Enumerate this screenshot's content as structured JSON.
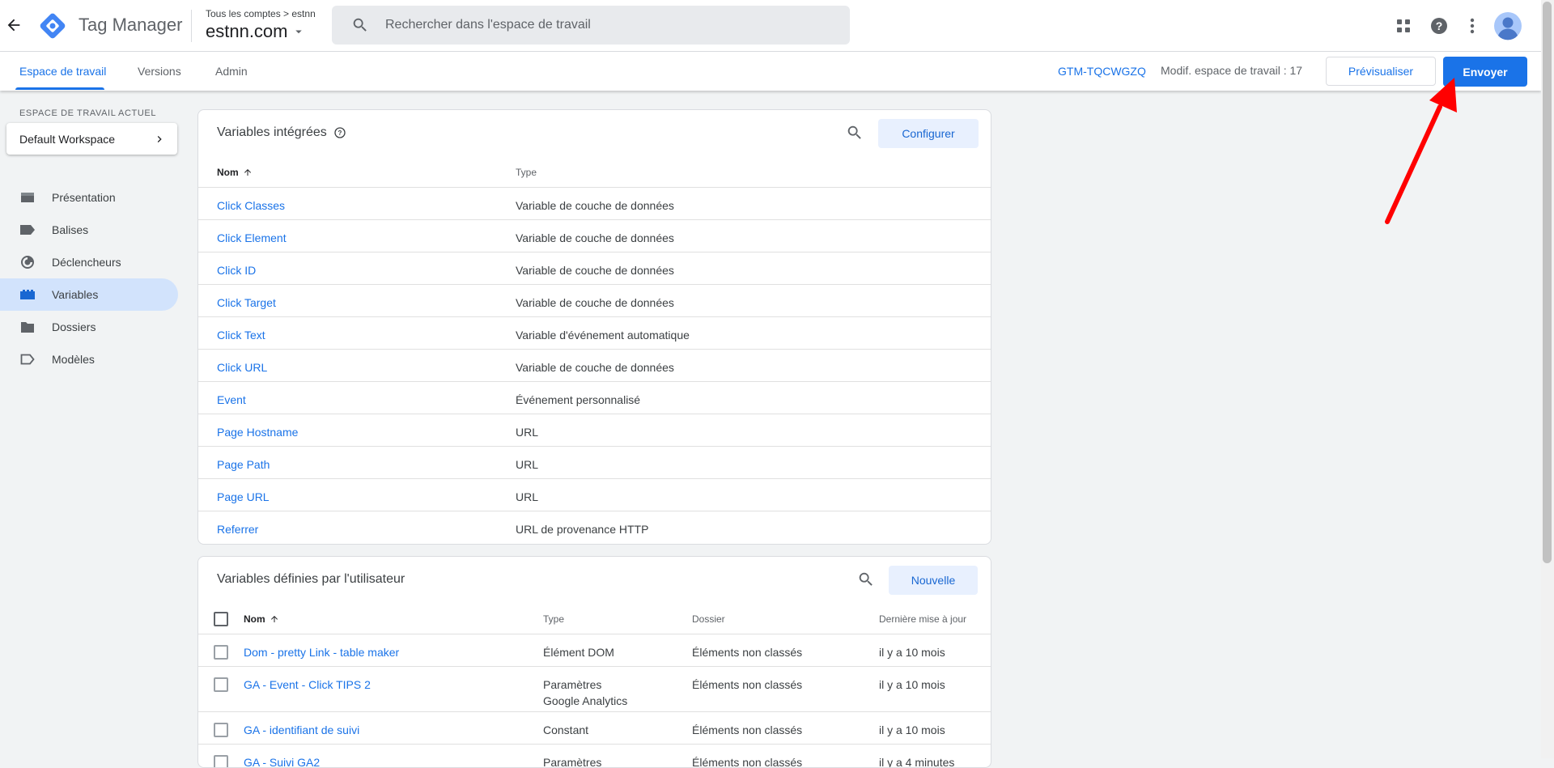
{
  "header": {
    "app_title": "Tag Manager",
    "breadcrumb": "Tous les comptes > estnn",
    "container_name": "estnn.com",
    "search_placeholder": "Rechercher dans l'espace de travail"
  },
  "subnav": {
    "tabs": [
      {
        "label": "Espace de travail",
        "active": true
      },
      {
        "label": "Versions",
        "active": false
      },
      {
        "label": "Admin",
        "active": false
      }
    ],
    "container_id": "GTM-TQCWGZQ",
    "workspace_changes": "Modif. espace de travail : 17",
    "preview_label": "Prévisualiser",
    "submit_label": "Envoyer"
  },
  "sidebar": {
    "workspace_label": "ESPACE DE TRAVAIL ACTUEL",
    "workspace_name": "Default Workspace",
    "items": [
      {
        "label": "Présentation",
        "icon": "overview-icon",
        "active": false
      },
      {
        "label": "Balises",
        "icon": "tag-icon",
        "active": false
      },
      {
        "label": "Déclencheurs",
        "icon": "trigger-icon",
        "active": false
      },
      {
        "label": "Variables",
        "icon": "variables-icon",
        "active": true
      },
      {
        "label": "Dossiers",
        "icon": "folder-icon",
        "active": false
      },
      {
        "label": "Modèles",
        "icon": "template-icon",
        "active": false
      }
    ]
  },
  "builtin": {
    "title": "Variables intégrées",
    "button": "Configurer",
    "columns": [
      "Nom",
      "Type"
    ],
    "rows": [
      {
        "name": "Click Classes",
        "type": "Variable de couche de données"
      },
      {
        "name": "Click Element",
        "type": "Variable de couche de données"
      },
      {
        "name": "Click ID",
        "type": "Variable de couche de données"
      },
      {
        "name": "Click Target",
        "type": "Variable de couche de données"
      },
      {
        "name": "Click Text",
        "type": "Variable d'événement automatique"
      },
      {
        "name": "Click URL",
        "type": "Variable de couche de données"
      },
      {
        "name": "Event",
        "type": "Événement personnalisé"
      },
      {
        "name": "Page Hostname",
        "type": "URL"
      },
      {
        "name": "Page Path",
        "type": "URL"
      },
      {
        "name": "Page URL",
        "type": "URL"
      },
      {
        "name": "Referrer",
        "type": "URL de provenance HTTP"
      }
    ]
  },
  "user": {
    "title": "Variables définies par l'utilisateur",
    "button": "Nouvelle",
    "columns": [
      "Nom",
      "Type",
      "Dossier",
      "Dernière mise à jour"
    ],
    "rows": [
      {
        "name": "Dom - pretty Link - table maker",
        "type": "Élément DOM",
        "type2": "",
        "folder": "Éléments non classés",
        "updated": "il y a 10 mois"
      },
      {
        "name": "GA - Event - Click TIPS 2",
        "type": "Paramètres",
        "type2": "Google Analytics",
        "folder": "Éléments non classés",
        "updated": "il y a 10 mois"
      },
      {
        "name": "GA - identifiant de suivi",
        "type": "Constant",
        "type2": "",
        "folder": "Éléments non classés",
        "updated": "il y a 10 mois"
      },
      {
        "name": "GA - Suivi GA2",
        "type": "Paramètres",
        "type2": "",
        "folder": "Éléments non classés",
        "updated": "il y a 4 minutes"
      }
    ]
  },
  "colors": {
    "accent": "#1a73e8",
    "annotation_arrow": "#ff0000",
    "sidebar_active": "#d2e3fc"
  }
}
